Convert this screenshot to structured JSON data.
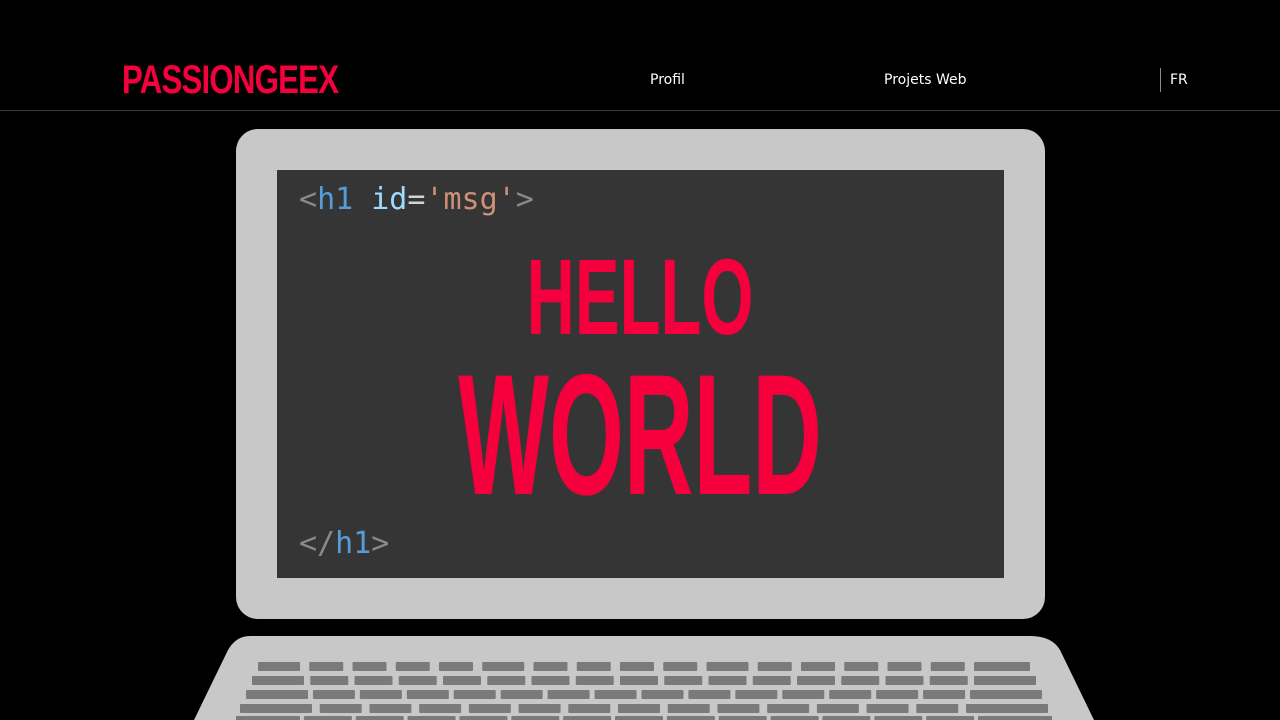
{
  "header": {
    "logo": "PASSIONGEEX",
    "nav": {
      "profil": "Profil",
      "projets_web": "Projets Web",
      "language": "FR"
    }
  },
  "hero": {
    "code_open": {
      "bracket_open": "<",
      "tag": "h1",
      "space": " ",
      "attr": "id",
      "eq": "=",
      "value": "'msg'",
      "bracket_close": ">"
    },
    "code_close": {
      "bracket_open": "</",
      "tag": "h1",
      "bracket_close": ">"
    },
    "headline_line1": "HELLO",
    "headline_line2": "WORLD"
  },
  "colors": {
    "brand_red": "#f5003d",
    "background": "#000000",
    "laptop_body": "#c8c8c8",
    "screen": "#353535",
    "keys": "#7a7a7a"
  }
}
